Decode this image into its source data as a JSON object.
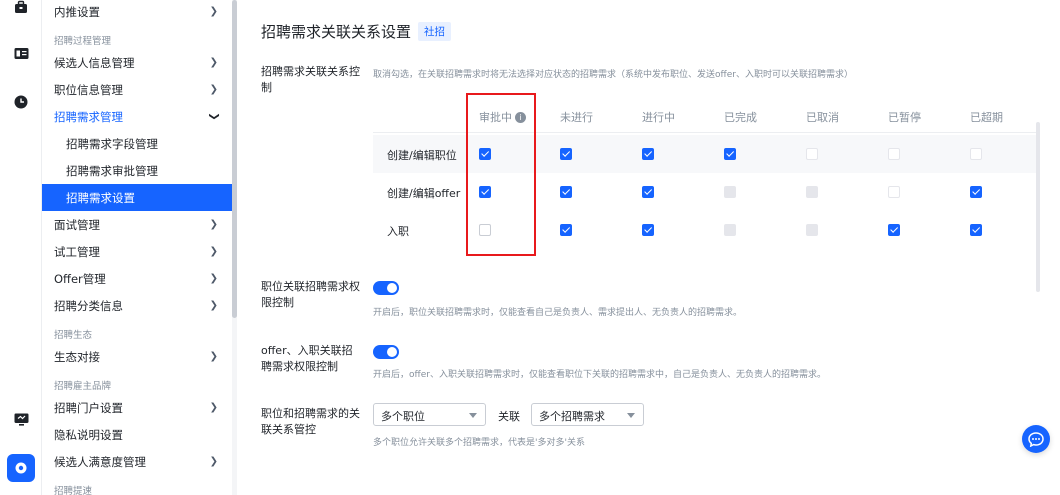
{
  "rail": {
    "icons": [
      "briefcase-icon",
      "id-card-icon",
      "clock-icon",
      "monitor-icon",
      "settings-icon"
    ]
  },
  "sidebar": {
    "items": [
      {
        "type": "item",
        "label": "内推设置",
        "chevron": "right"
      },
      {
        "type": "group",
        "label": "招聘过程管理"
      },
      {
        "type": "item",
        "label": "候选人信息管理",
        "chevron": "right"
      },
      {
        "type": "item",
        "label": "职位信息管理",
        "chevron": "right"
      },
      {
        "type": "item",
        "label": "招聘需求管理",
        "chevron": "down",
        "open": true
      },
      {
        "type": "sub",
        "label": "招聘需求字段管理"
      },
      {
        "type": "sub",
        "label": "招聘需求审批管理"
      },
      {
        "type": "sub",
        "label": "招聘需求设置",
        "selected": true
      },
      {
        "type": "item",
        "label": "面试管理",
        "chevron": "right"
      },
      {
        "type": "item",
        "label": "试工管理",
        "chevron": "right"
      },
      {
        "type": "item",
        "label": "Offer管理",
        "chevron": "right"
      },
      {
        "type": "item",
        "label": "招聘分类信息",
        "chevron": "right"
      },
      {
        "type": "group",
        "label": "招聘生态"
      },
      {
        "type": "item",
        "label": "生态对接",
        "chevron": "right"
      },
      {
        "type": "group",
        "label": "招聘雇主品牌"
      },
      {
        "type": "item",
        "label": "招聘门户设置",
        "chevron": "right"
      },
      {
        "type": "item",
        "label": "隐私说明设置"
      },
      {
        "type": "item",
        "label": "候选人满意度管理",
        "chevron": "right"
      },
      {
        "type": "group",
        "label": "招聘提速"
      }
    ]
  },
  "main": {
    "title": "招聘需求关联关系设置",
    "tag": "社招",
    "section1": {
      "label": "招聘需求关联关系控制",
      "desc": "取消勾选，在关联招聘需求时将无法选择对应状态的招聘需求（系统中发布职位、发送offer、入职时可以关联招聘需求）"
    },
    "table": {
      "columns": [
        "审批中",
        "未进行",
        "进行中",
        "已完成",
        "已取消",
        "已暂停",
        "已超期"
      ],
      "rows": [
        {
          "label": "创建/编辑职位",
          "states": [
            "on",
            "on",
            "on",
            "on",
            "dis-off",
            "dis-off",
            "dis-off"
          ]
        },
        {
          "label": "创建/编辑offer",
          "states": [
            "on",
            "on",
            "on",
            "dis",
            "dis",
            "dis-off",
            "on"
          ]
        },
        {
          "label": "入职",
          "states": [
            "off",
            "on",
            "on",
            "dis",
            "dis",
            "on",
            "on"
          ]
        }
      ]
    },
    "section2": {
      "label": "职位关联招聘需求权限控制",
      "toggle": "on",
      "desc": "开启后，职位关联招聘需求时，仅能查看自己是负责人、需求提出人、无负责人的招聘需求。"
    },
    "section3": {
      "label": "offer、入职关联招聘需求权限控制",
      "toggle": "on",
      "desc": "开启后，offer、入职关联招聘需求时，仅能查看职位下关联的招聘需求中，自己是负责人、无负责人的招聘需求。"
    },
    "section4": {
      "label": "职位和招聘需求的关联关系管控",
      "select1": "多个职位",
      "relation": "关联",
      "select2": "多个招聘需求",
      "desc": "多个职位允许关联多个招聘需求，代表是'多对多'关系"
    }
  },
  "colors": {
    "accent": "#1664ff",
    "highlight_box": "#e8191c"
  }
}
